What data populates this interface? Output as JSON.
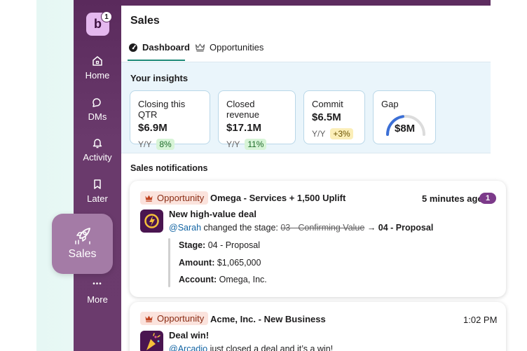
{
  "workspace": {
    "initial": "b",
    "badge": "1"
  },
  "sidebar": {
    "items": [
      {
        "label": "Home",
        "icon": "home-icon"
      },
      {
        "label": "DMs",
        "icon": "dms-icon"
      },
      {
        "label": "Activity",
        "icon": "bell-icon"
      },
      {
        "label": "Later",
        "icon": "bookmark-icon"
      }
    ],
    "active": {
      "label": "Sales",
      "icon": "sales-rocket-icon"
    },
    "more": {
      "glyph": "•••",
      "label": "More"
    }
  },
  "page": {
    "title": "Sales"
  },
  "tabs": [
    {
      "label": "Dashboard",
      "icon": "dashboard-gauge-icon",
      "active": true
    },
    {
      "label": "Opportunities",
      "icon": "crown-icon",
      "active": false
    }
  ],
  "insights": {
    "title": "Your insights",
    "cards": [
      {
        "label": "Closing this QTR",
        "value": "$6.9M",
        "yy": "Y/Y",
        "change": "8%",
        "tone": "green"
      },
      {
        "label": "Closed revenue",
        "value": "$17.1M",
        "yy": "Y/Y",
        "change": "11%",
        "tone": "green"
      },
      {
        "label": "Commit",
        "value": "$6.5M",
        "yy": "Y/Y",
        "change": "+3%",
        "tone": "yellow"
      }
    ],
    "gap": {
      "label": "Gap",
      "value": "$8M",
      "level": 0.45,
      "color": "#3b6fd6"
    }
  },
  "notifications": {
    "title": "Sales notifications",
    "items": [
      {
        "tag": "Opportunity",
        "name": "Omega - Services + 1,500 Uplift",
        "time": "5 minutes ago",
        "badge": "1",
        "headline": "New high-value deal",
        "mention": "@Sarah",
        "action": "changed the stage:",
        "old_stage": "03 - Confirming Value",
        "arrow": "→",
        "new_stage": "04 - Proposal",
        "details": [
          {
            "label": "Stage:",
            "value": "04 - Proposal"
          },
          {
            "label": "Amount:",
            "value": "$1,065,000"
          },
          {
            "label": "Account:",
            "value": "Omega, Inc."
          }
        ]
      },
      {
        "tag": "Opportunity",
        "name": "Acme, Inc. - New Business",
        "time": "1:02 PM",
        "headline": "Deal win!",
        "mention": "@Arcadio",
        "action": "just closed a deal and it’s a win!"
      }
    ]
  }
}
